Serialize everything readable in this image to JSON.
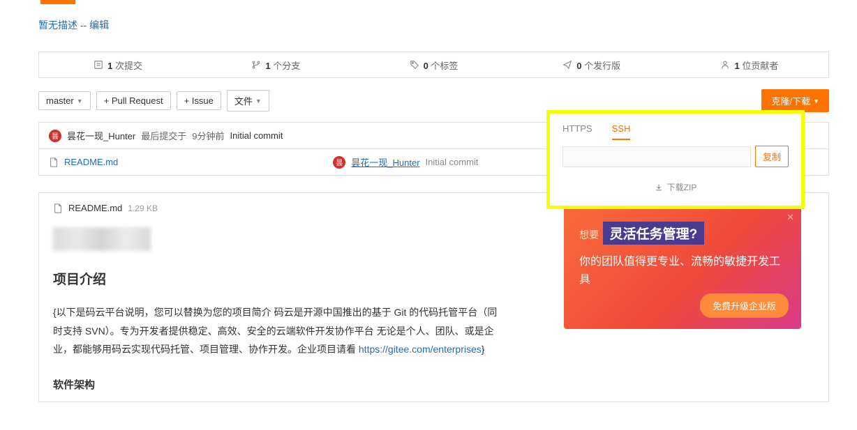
{
  "description": {
    "none": "暂无描述 -- ",
    "edit": "编辑"
  },
  "stats": {
    "commits": {
      "count": "1",
      "label": "次提交"
    },
    "branches": {
      "count": "1",
      "label": "个分支"
    },
    "tags": {
      "count": "0",
      "label": "个标签"
    },
    "releases": {
      "count": "0",
      "label": "个发行版"
    },
    "contributors": {
      "count": "1",
      "label": "位贡献者"
    }
  },
  "toolbar": {
    "branch": "master",
    "pull_request": "+ Pull Request",
    "issue": "+ Issue",
    "files": "文件",
    "clone": "克隆/下载"
  },
  "commit": {
    "author": "昙花一现_Hunter",
    "prefix": "最后提交于",
    "time": "9分钟前",
    "message": "Initial commit"
  },
  "file": {
    "name": "README.md",
    "author": "昙花一现_Hunter",
    "message": "Initial commit"
  },
  "readme": {
    "filename": "README.md",
    "size": "1.29 KB",
    "title": "项目介绍",
    "body_part1": "{以下是码云平台说明，您可以替换为您的项目简介 码云是开源中国推出的基于 Git 的代码托管平台（同时支持 SVN）。专为开发者提供稳定、高效、安全的云端软件开发协作平台 无论是个人、团队、或是企业，都能够用码云实现代码托管、项目管理、协作开发。企业项目请看 ",
    "link": "https://gitee.com/enterprises",
    "body_part2": "}",
    "subtitle": "软件架构"
  },
  "popup": {
    "tab_https": "HTTPS",
    "tab_ssh": "SSH",
    "url_value": "",
    "copy": "复制",
    "download_zip": "下载ZIP"
  },
  "promo": {
    "wanted": "想要",
    "big": "灵活任务管理?",
    "line2": "你的团队值得更专业、流畅的敏捷开发工具",
    "cta": "免费升级企业版"
  }
}
